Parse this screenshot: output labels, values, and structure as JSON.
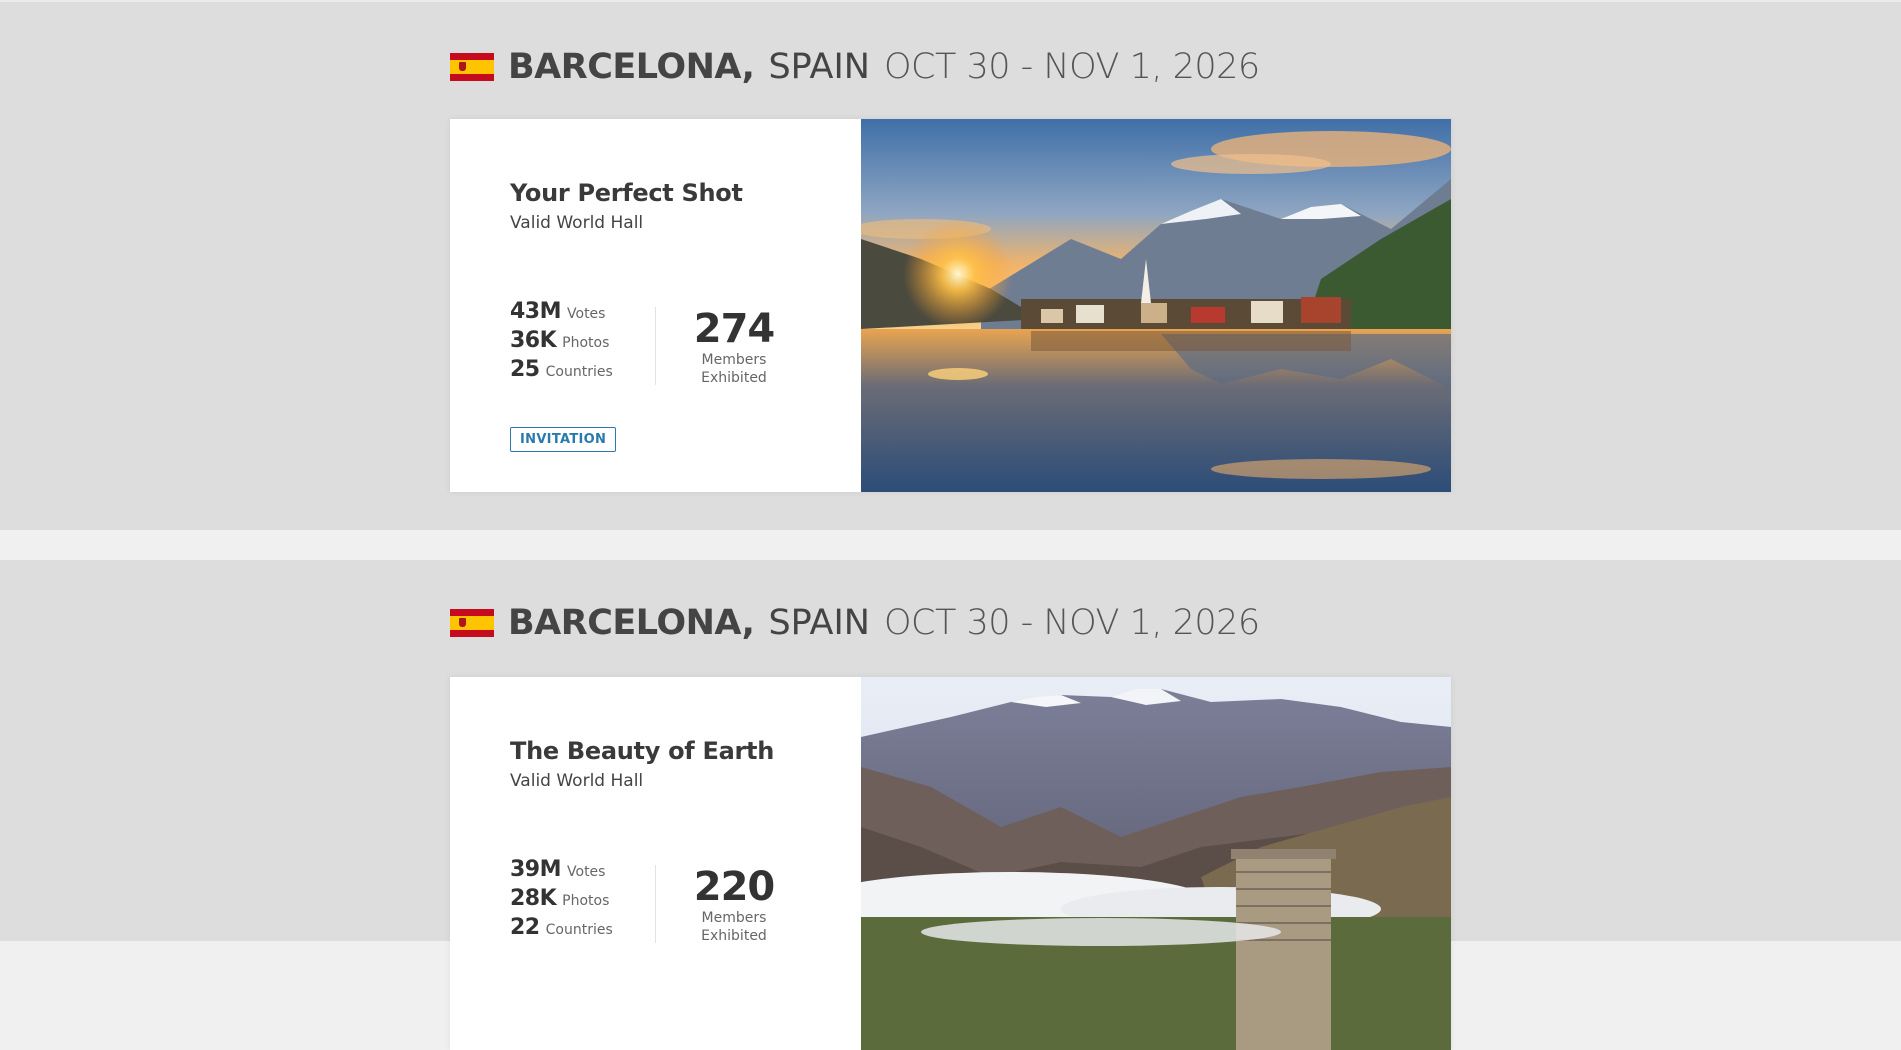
{
  "events": [
    {
      "city": "BARCELONA,",
      "country": "SPAIN",
      "dates": "OCT 30 - NOV 1, 2026",
      "flag_icon": "spain-flag-icon",
      "title": "Your Perfect Shot",
      "venue": "Valid World Hall",
      "stats": [
        {
          "value": "43M",
          "label": "Votes"
        },
        {
          "value": "36K",
          "label": "Photos"
        },
        {
          "value": "25",
          "label": "Countries"
        }
      ],
      "members_count": "274",
      "members_label_1": "Members",
      "members_label_2": "Exhibited",
      "badge": "INVITATION",
      "photo": "alpine-lake-village-sunrise"
    },
    {
      "city": "BARCELONA,",
      "country": "SPAIN",
      "dates": "OCT 30 - NOV 1, 2026",
      "flag_icon": "spain-flag-icon",
      "title": "The Beauty of Earth",
      "venue": "Valid World Hall",
      "stats": [
        {
          "value": "39M",
          "label": "Votes"
        },
        {
          "value": "28K",
          "label": "Photos"
        },
        {
          "value": "22",
          "label": "Countries"
        }
      ],
      "members_count": "220",
      "members_label_1": "Members",
      "members_label_2": "Exhibited",
      "photo": "mountain-valley-stone-tower"
    }
  ],
  "colors": {
    "page_bg": "#f0f0f0",
    "section_bg": "#dddddd",
    "accent": "#2a7ab0",
    "text": "#333333"
  }
}
